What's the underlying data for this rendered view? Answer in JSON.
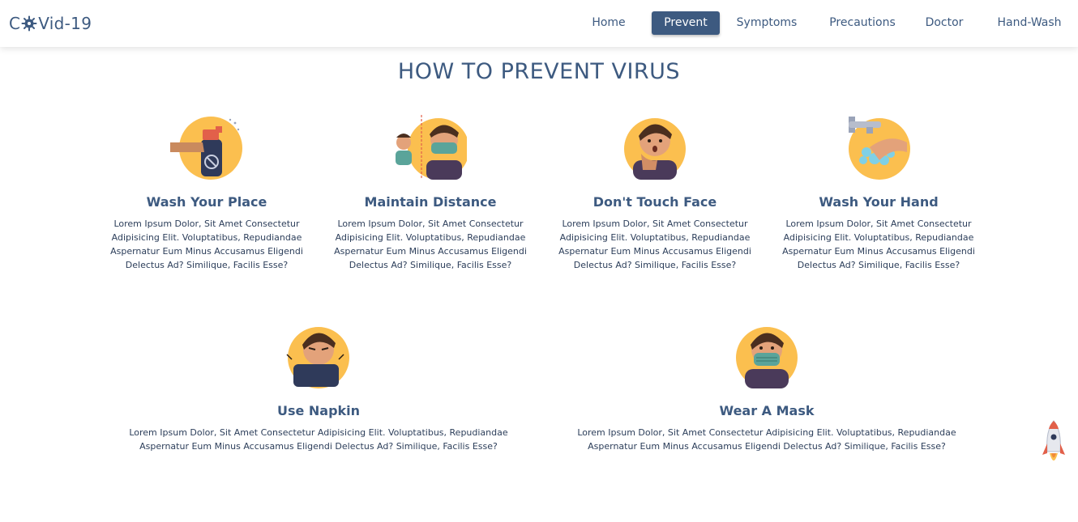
{
  "header": {
    "logo": {
      "prefix": "C",
      "suffix": "Vid-19",
      "icon": "virus-icon"
    },
    "nav": [
      {
        "label": "Home",
        "active": false
      },
      {
        "label": "Prevent",
        "active": true
      },
      {
        "label": "Symptoms",
        "active": false
      },
      {
        "label": "Precautions",
        "active": false
      },
      {
        "label": "Doctor",
        "active": false
      },
      {
        "label": "Hand-Wash",
        "active": false
      }
    ]
  },
  "main": {
    "title": "HOW TO PREVENT VIRUS",
    "cards": [
      {
        "title": "Wash Your Place",
        "icon": "spray-bottle-icon",
        "desc": "Lorem Ipsum Dolor, Sit Amet Consectetur Adipisicing Elit. Voluptatibus, Repudiandae Aspernatur Eum Minus Accusamus Eligendi Delectus Ad? Similique, Facilis Esse?"
      },
      {
        "title": "Maintain Distance",
        "icon": "social-distance-icon",
        "desc": "Lorem Ipsum Dolor, Sit Amet Consectetur Adipisicing Elit. Voluptatibus, Repudiandae Aspernatur Eum Minus Accusamus Eligendi Delectus Ad? Similique, Facilis Esse?"
      },
      {
        "title": "Don't Touch Face",
        "icon": "touch-face-icon",
        "desc": "Lorem Ipsum Dolor, Sit Amet Consectetur Adipisicing Elit. Voluptatibus, Repudiandae Aspernatur Eum Minus Accusamus Eligendi Delectus Ad? Similique, Facilis Esse?"
      },
      {
        "title": "Wash Your Hand",
        "icon": "hand-wash-icon",
        "desc": "Lorem Ipsum Dolor, Sit Amet Consectetur Adipisicing Elit. Voluptatibus, Repudiandae Aspernatur Eum Minus Accusamus Eligendi Delectus Ad? Similique, Facilis Esse?"
      },
      {
        "title": "Use Napkin",
        "icon": "napkin-icon",
        "desc": "Lorem Ipsum Dolor, Sit Amet Consectetur Adipisicing Elit. Voluptatibus, Repudiandae Aspernatur Eum Minus Accusamus Eligendi Delectus Ad? Similique, Facilis Esse?"
      },
      {
        "title": "Wear A Mask",
        "icon": "face-mask-icon",
        "desc": "Lorem Ipsum Dolor, Sit Amet Consectetur Adipisicing Elit. Voluptatibus, Repudiandae Aspernatur Eum Minus Accusamus Eligendi Delectus Ad? Similique, Facilis Esse?"
      }
    ]
  },
  "scroll_top": {
    "icon": "rocket-icon"
  },
  "colors": {
    "primary": "#3d5a80",
    "accent": "#fbbf4f",
    "text": "#2c3e5a",
    "background": "#ffffff"
  }
}
